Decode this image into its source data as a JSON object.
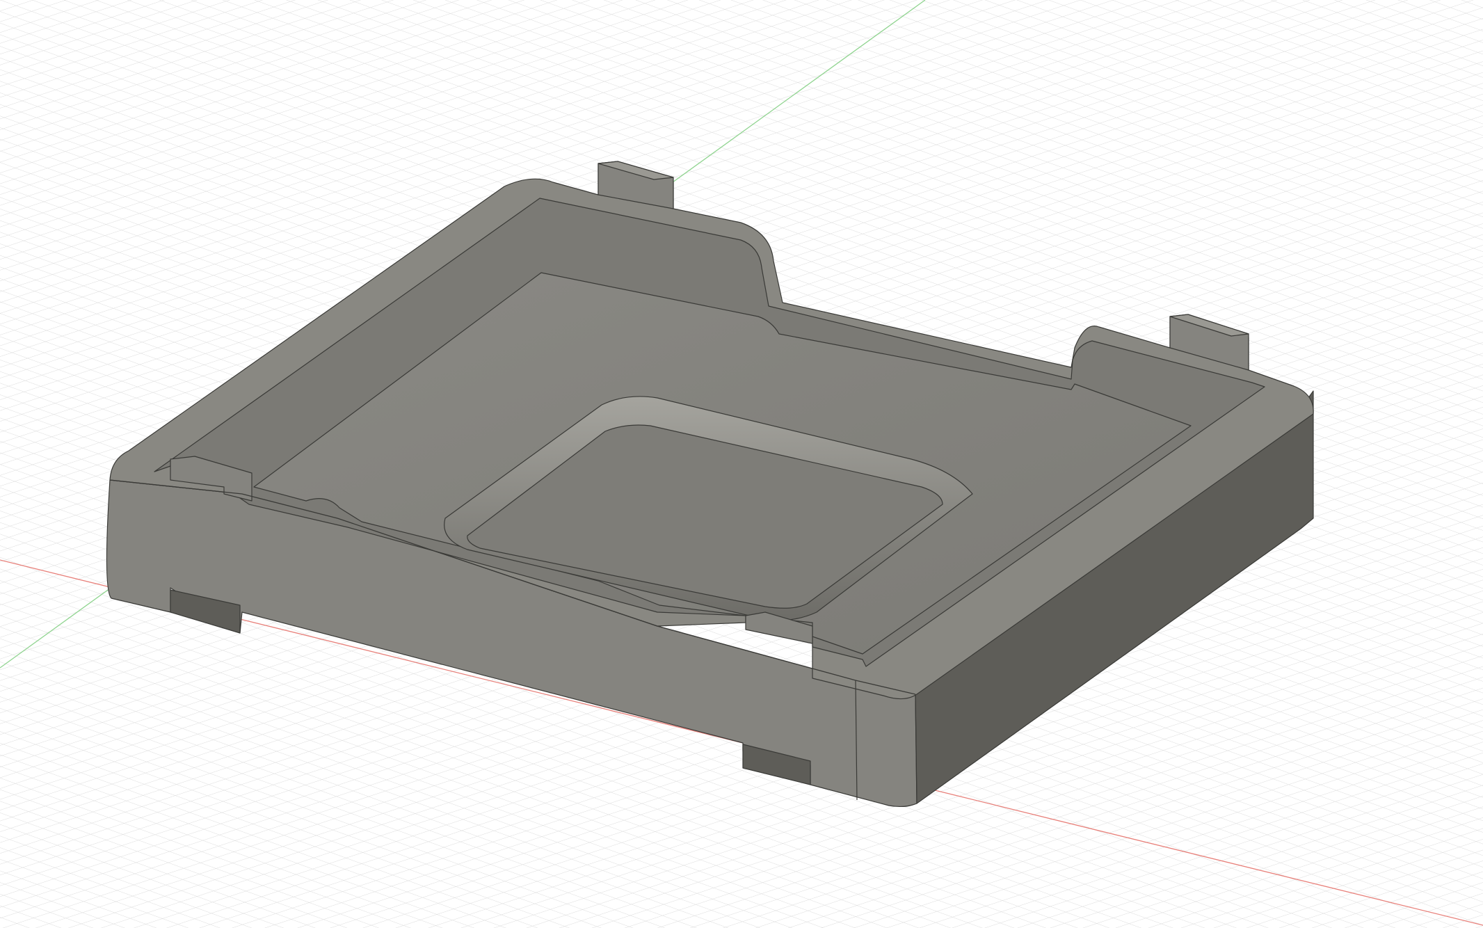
{
  "app": {
    "name": ""
  },
  "viewport": {
    "view": "3d-model-viewport",
    "background_color": "#ffffff",
    "grid_color": "#d6d6d6",
    "x_axis_color": "#e8807a",
    "y_axis_color": "#8fd48f"
  },
  "model": {
    "name": "",
    "body_color": "#85847f",
    "top_face_color": "#898882",
    "inner_floor_color": "#807f79",
    "right_side_color": "#5e5d58",
    "edge_color": "#3a3a37",
    "highlight_color": "#a3a29c"
  }
}
